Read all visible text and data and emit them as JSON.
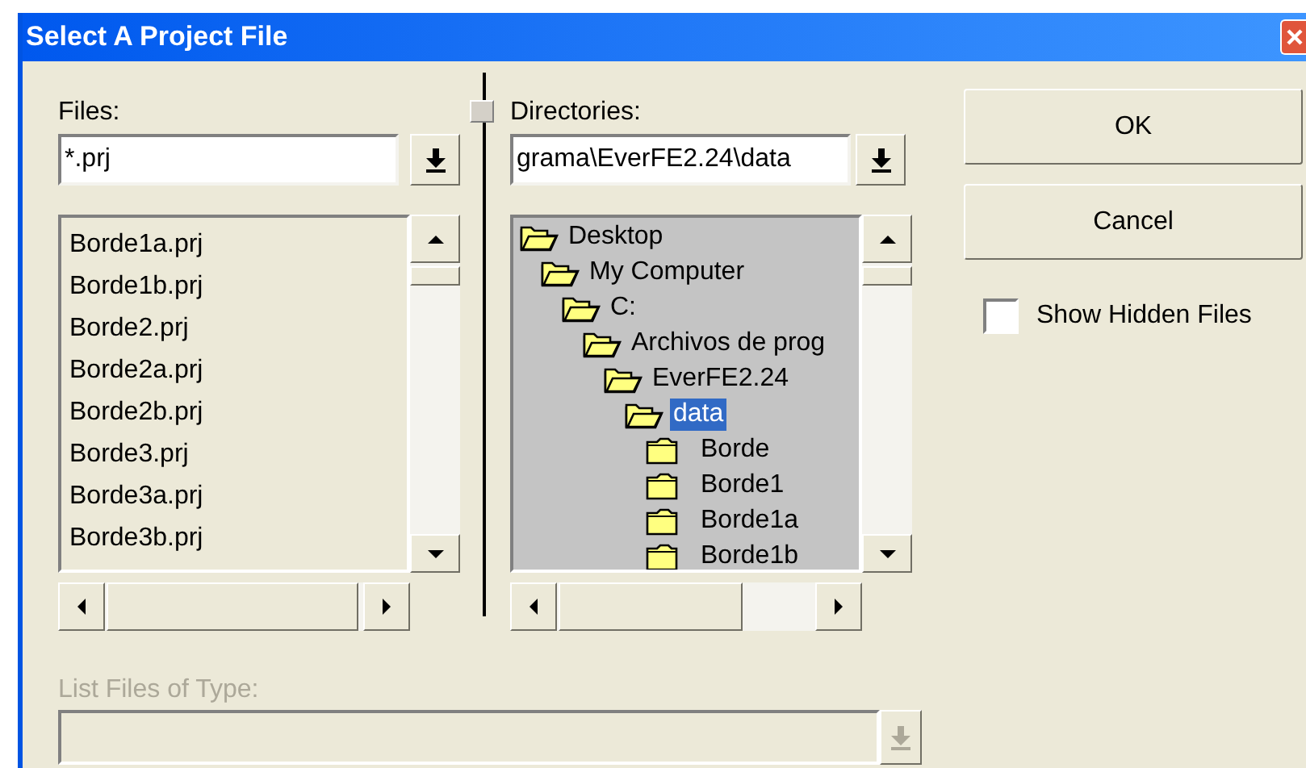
{
  "window": {
    "title": "Select A Project File"
  },
  "files": {
    "label": "Files:",
    "filter": "*.prj",
    "items": [
      {
        "name": "Borde1a.prj",
        "selected": false
      },
      {
        "name": "Borde1b.prj",
        "selected": false
      },
      {
        "name": "Borde2.prj",
        "selected": false
      },
      {
        "name": "Borde2a.prj",
        "selected": false
      },
      {
        "name": "Borde2b.prj",
        "selected": false
      },
      {
        "name": "Borde3.prj",
        "selected": false
      },
      {
        "name": "Borde3a.prj",
        "selected": false
      },
      {
        "name": "Borde3b.prj",
        "selected": false
      }
    ]
  },
  "directories": {
    "label": "Directories:",
    "path": "grama\\EverFE2.24\\data",
    "tree": [
      {
        "name": "Desktop",
        "expanded": true,
        "selected": false,
        "children": [
          {
            "name": "My Computer",
            "expanded": true,
            "selected": false,
            "children": [
              {
                "name": "C:",
                "expanded": true,
                "selected": false,
                "children": [
                  {
                    "name": "Archivos de prog",
                    "expanded": true,
                    "selected": false,
                    "children": [
                      {
                        "name": "EverFE2.24",
                        "expanded": true,
                        "selected": false,
                        "children": [
                          {
                            "name": "data",
                            "expanded": true,
                            "selected": true,
                            "children": [
                              {
                                "name": "Borde",
                                "expanded": false,
                                "selected": false
                              },
                              {
                                "name": "Borde1",
                                "expanded": false,
                                "selected": false
                              },
                              {
                                "name": "Borde1a",
                                "expanded": false,
                                "selected": false
                              },
                              {
                                "name": "Borde1b",
                                "expanded": false,
                                "selected": false
                              }
                            ]
                          }
                        ]
                      }
                    ]
                  }
                ]
              }
            ]
          }
        ]
      }
    ]
  },
  "buttons": [
    "OK",
    "Cancel"
  ],
  "show_hidden_files": {
    "label": "Show Hidden Files",
    "checked": false
  },
  "file_type": {
    "label": "List Files of Type:",
    "disabled": true
  }
}
